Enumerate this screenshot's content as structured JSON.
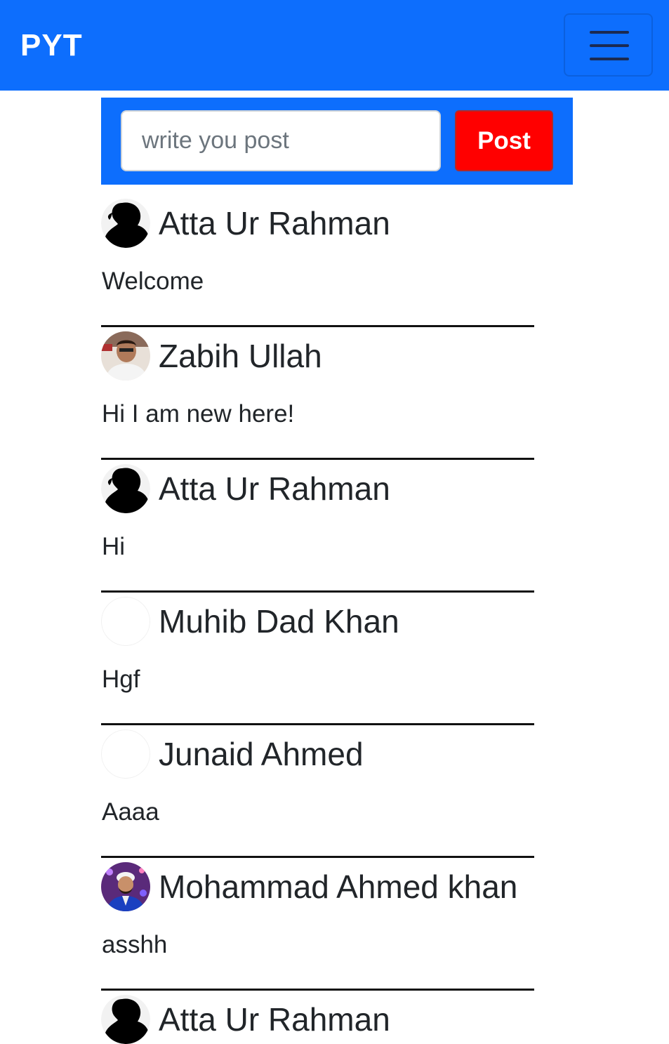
{
  "navbar": {
    "brand": "PYT",
    "menu_icon": "hamburger-menu-icon",
    "background": "#0d6efd"
  },
  "composer": {
    "placeholder": "write you post",
    "value": "",
    "post_label": "Post",
    "button_color": "#ff0000"
  },
  "posts": [
    {
      "author": "Atta Ur Rahman",
      "content": "Welcome",
      "avatar": "silhouette-avatar"
    },
    {
      "author": "Zabih Ullah",
      "content": "Hi I am new here!",
      "avatar": "photo-avatar"
    },
    {
      "author": "Atta Ur Rahman",
      "content": "Hi",
      "avatar": "silhouette-avatar"
    },
    {
      "author": "Muhib Dad Khan",
      "content": "Hgf",
      "avatar": "blank-avatar"
    },
    {
      "author": "Junaid Ahmed",
      "content": "Aaaa",
      "avatar": "blank-avatar"
    },
    {
      "author": "Mohammad Ahmed khan",
      "content": "asshh",
      "avatar": "photo-avatar"
    },
    {
      "author": "Atta Ur Rahman",
      "content": "",
      "avatar": "silhouette-avatar"
    }
  ]
}
